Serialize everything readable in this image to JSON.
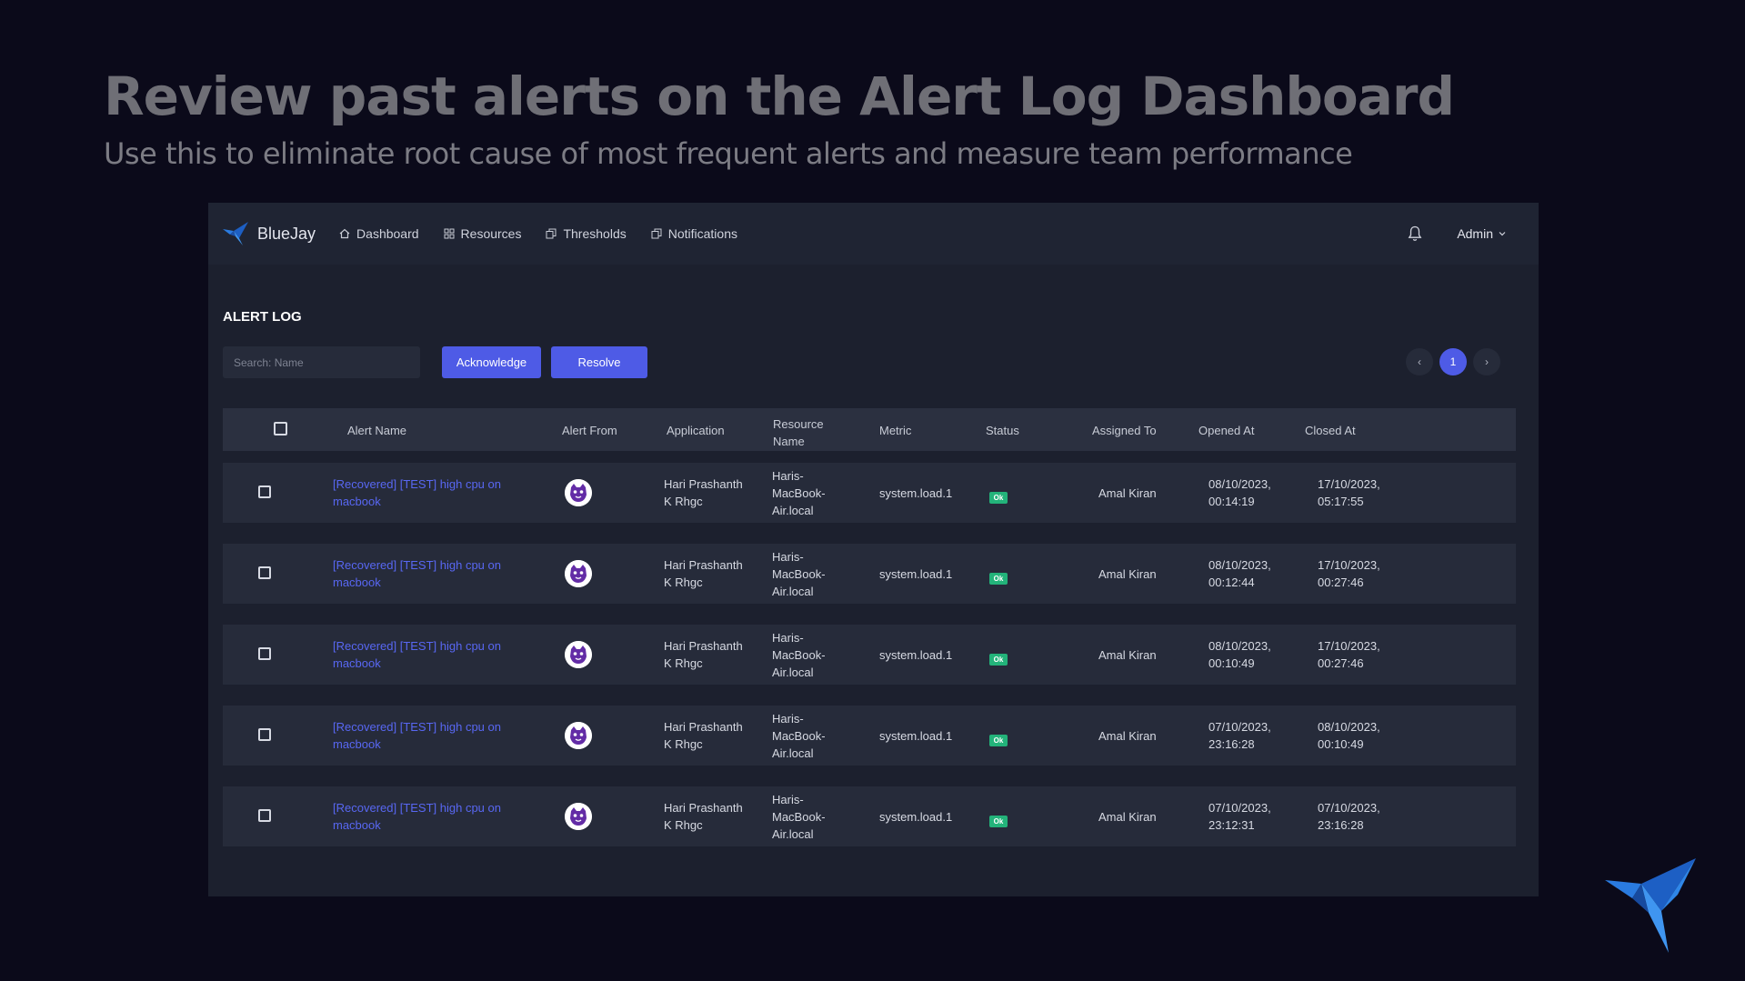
{
  "slide": {
    "title": "Review past alerts on the Alert Log Dashboard",
    "subtitle": "Use this to eliminate root cause of most frequent alerts and measure team performance"
  },
  "app": {
    "brand": "BlueJay",
    "nav": [
      {
        "label": "Dashboard",
        "icon": "home-icon"
      },
      {
        "label": "Resources",
        "icon": "grid-icon"
      },
      {
        "label": "Thresholds",
        "icon": "copy-icon"
      },
      {
        "label": "Notifications",
        "icon": "copy-icon"
      }
    ],
    "user": "Admin",
    "colors": {
      "accent": "#4e5be6",
      "link": "#5867f2",
      "ok": "#23b37a"
    }
  },
  "alert_log": {
    "heading": "ALERT LOG",
    "search_placeholder": "Search: Name",
    "acknowledge": "Acknowledge",
    "resolve": "Resolve",
    "pagination": {
      "prev": "‹",
      "page": "1",
      "next": "›"
    },
    "columns": {
      "alert_name": "Alert Name",
      "alert_from": "Alert From",
      "application": "Application",
      "resource_name_1": "Resource",
      "resource_name_2": "Name",
      "metric": "Metric",
      "status": "Status",
      "assigned_to": "Assigned To",
      "opened_at": "Opened At",
      "closed_at": "Closed At"
    },
    "rows": [
      {
        "name1": "[Recovered] [TEST] high cpu on",
        "name2": "macbook",
        "app1": "Hari Prashanth",
        "app2": "K Rhgc",
        "res1": "Haris-",
        "res2": "MacBook-",
        "res3": "Air.local",
        "metric": "system.load.1",
        "status": "Ok",
        "assigned": "Amal Kiran",
        "open1": "08/10/2023,",
        "open2": "00:14:19",
        "close1": "17/10/2023,",
        "close2": "05:17:55"
      },
      {
        "name1": "[Recovered] [TEST] high cpu on",
        "name2": "macbook",
        "app1": "Hari Prashanth",
        "app2": "K Rhgc",
        "res1": "Haris-",
        "res2": "MacBook-",
        "res3": "Air.local",
        "metric": "system.load.1",
        "status": "Ok",
        "assigned": "Amal Kiran",
        "open1": "08/10/2023,",
        "open2": "00:12:44",
        "close1": "17/10/2023,",
        "close2": "00:27:46"
      },
      {
        "name1": "[Recovered] [TEST] high cpu on",
        "name2": "macbook",
        "app1": "Hari Prashanth",
        "app2": "K Rhgc",
        "res1": "Haris-",
        "res2": "MacBook-",
        "res3": "Air.local",
        "metric": "system.load.1",
        "status": "Ok",
        "assigned": "Amal Kiran",
        "open1": "08/10/2023,",
        "open2": "00:10:49",
        "close1": "17/10/2023,",
        "close2": "00:27:46"
      },
      {
        "name1": "[Recovered] [TEST] high cpu on",
        "name2": "macbook",
        "app1": "Hari Prashanth",
        "app2": "K Rhgc",
        "res1": "Haris-",
        "res2": "MacBook-",
        "res3": "Air.local",
        "metric": "system.load.1",
        "status": "Ok",
        "assigned": "Amal Kiran",
        "open1": "07/10/2023,",
        "open2": "23:16:28",
        "close1": "08/10/2023,",
        "close2": "00:10:49"
      },
      {
        "name1": "[Recovered] [TEST] high cpu on",
        "name2": "macbook",
        "app1": "Hari Prashanth",
        "app2": "K Rhgc",
        "res1": "Haris-",
        "res2": "MacBook-",
        "res3": "Air.local",
        "metric": "system.load.1",
        "status": "Ok",
        "assigned": "Amal Kiran",
        "open1": "07/10/2023,",
        "open2": "23:12:31",
        "close1": "07/10/2023,",
        "close2": "23:16:28"
      }
    ]
  }
}
